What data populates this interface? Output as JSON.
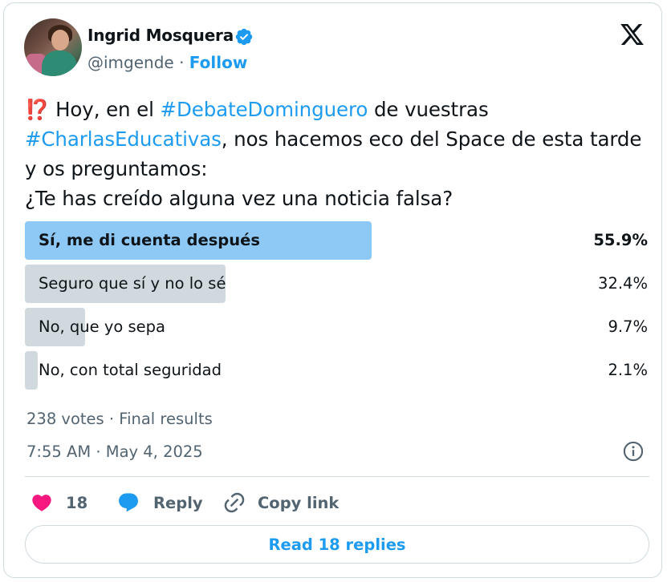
{
  "author": {
    "name": "Ingrid Mosquera",
    "handle": "@imgende",
    "separator": "·",
    "follow_label": "Follow",
    "verified_icon": "verified-badge-icon",
    "verified_color": "#1d9bf0"
  },
  "platform_logo": "x-logo-icon",
  "tweet": {
    "emoji": "⁉️",
    "text_1": " Hoy, en el ",
    "hashtag_1": "#DebateDominguero",
    "text_2": " de vuestras",
    "hashtag_2": "#CharlasEducativas",
    "text_3": ", nos hacemos eco del Space de esta tarde y os preguntamos:",
    "text_4": "¿Te has creído alguna vez una noticia falsa?"
  },
  "poll": {
    "options": [
      {
        "label": "Sí, me di cuenta después",
        "percent_label": "55.9%",
        "fraction": 0.559,
        "winner": true
      },
      {
        "label": "Seguro que sí y no lo sé",
        "percent_label": "32.4%",
        "fraction": 0.324,
        "winner": false
      },
      {
        "label": "No, que yo sepa",
        "percent_label": "9.7%",
        "fraction": 0.097,
        "winner": false
      },
      {
        "label": "No, con total seguridad",
        "percent_label": "2.1%",
        "fraction": 0.021,
        "winner": false
      }
    ],
    "summary": "238 votes · Final results",
    "winner_color": "#8ec9f6",
    "other_color": "#cfd9de"
  },
  "timestamp": "7:55 AM · May 4, 2025",
  "actions": {
    "like_count": "18",
    "reply_label": "Reply",
    "copy_link_label": "Copy link",
    "like_color": "#f91880",
    "reply_color": "#1d9bf0"
  },
  "read_replies_label": "Read 18 replies",
  "accent_color": "#1d9bf0"
}
